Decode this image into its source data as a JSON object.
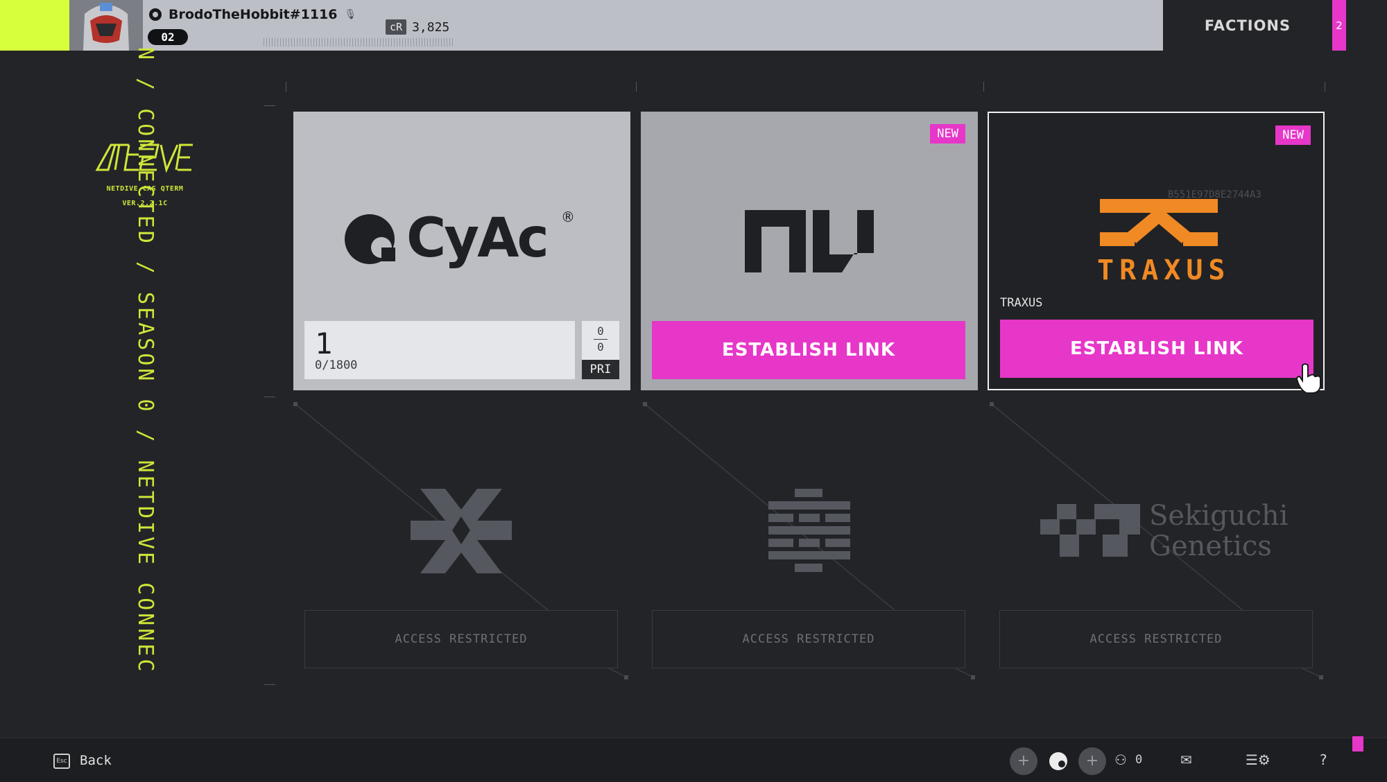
{
  "topbar": {
    "username": "BrodoTheHobbit#1116",
    "level": "02",
    "credits_label": "cR",
    "credits_amount": "3,825",
    "factions_label": "FACTIONS",
    "factions_badge": "2"
  },
  "sidebar": {
    "status_text": "N / CONNECTED / SEASON 0 / NETDIVE CONNEC",
    "brand_logo": "NETDIVE",
    "brand_line1": "NETDIVE CAS QTERM",
    "brand_line2": "VER.2.2.1C"
  },
  "factions": [
    {
      "name": "CyAc",
      "logo_text": "CyAc",
      "rank": "1",
      "progress": "0/1800",
      "fraction_top": "0",
      "fraction_bottom": "0",
      "tag": "PRI"
    },
    {
      "name": "NuCaloric",
      "badge": "NEW",
      "button": "ESTABLISH LINK"
    },
    {
      "name": "TRAXUS",
      "badge": "NEW",
      "logo_text": "TRAXUS",
      "id_code": "B551E97D8E2744A3",
      "label": "TRAXUS",
      "button": "ESTABLISH LINK"
    }
  ],
  "restricted": [
    {
      "logo": "x-emblem-icon",
      "label": "ACCESS RESTRICTED"
    },
    {
      "logo": "checker-emblem-icon",
      "label": "ACCESS RESTRICTED"
    },
    {
      "logo_text_1": "Sekiguchi",
      "logo_text_2": "Genetics",
      "label": "ACCESS RESTRICTED"
    }
  ],
  "bottombar": {
    "esc_label": "Esc",
    "back_label": "Back",
    "party_count": "0"
  },
  "colors": {
    "accent_pink": "#e637c8",
    "accent_lime": "#d7ff3c",
    "traxus_orange": "#f08a24"
  }
}
